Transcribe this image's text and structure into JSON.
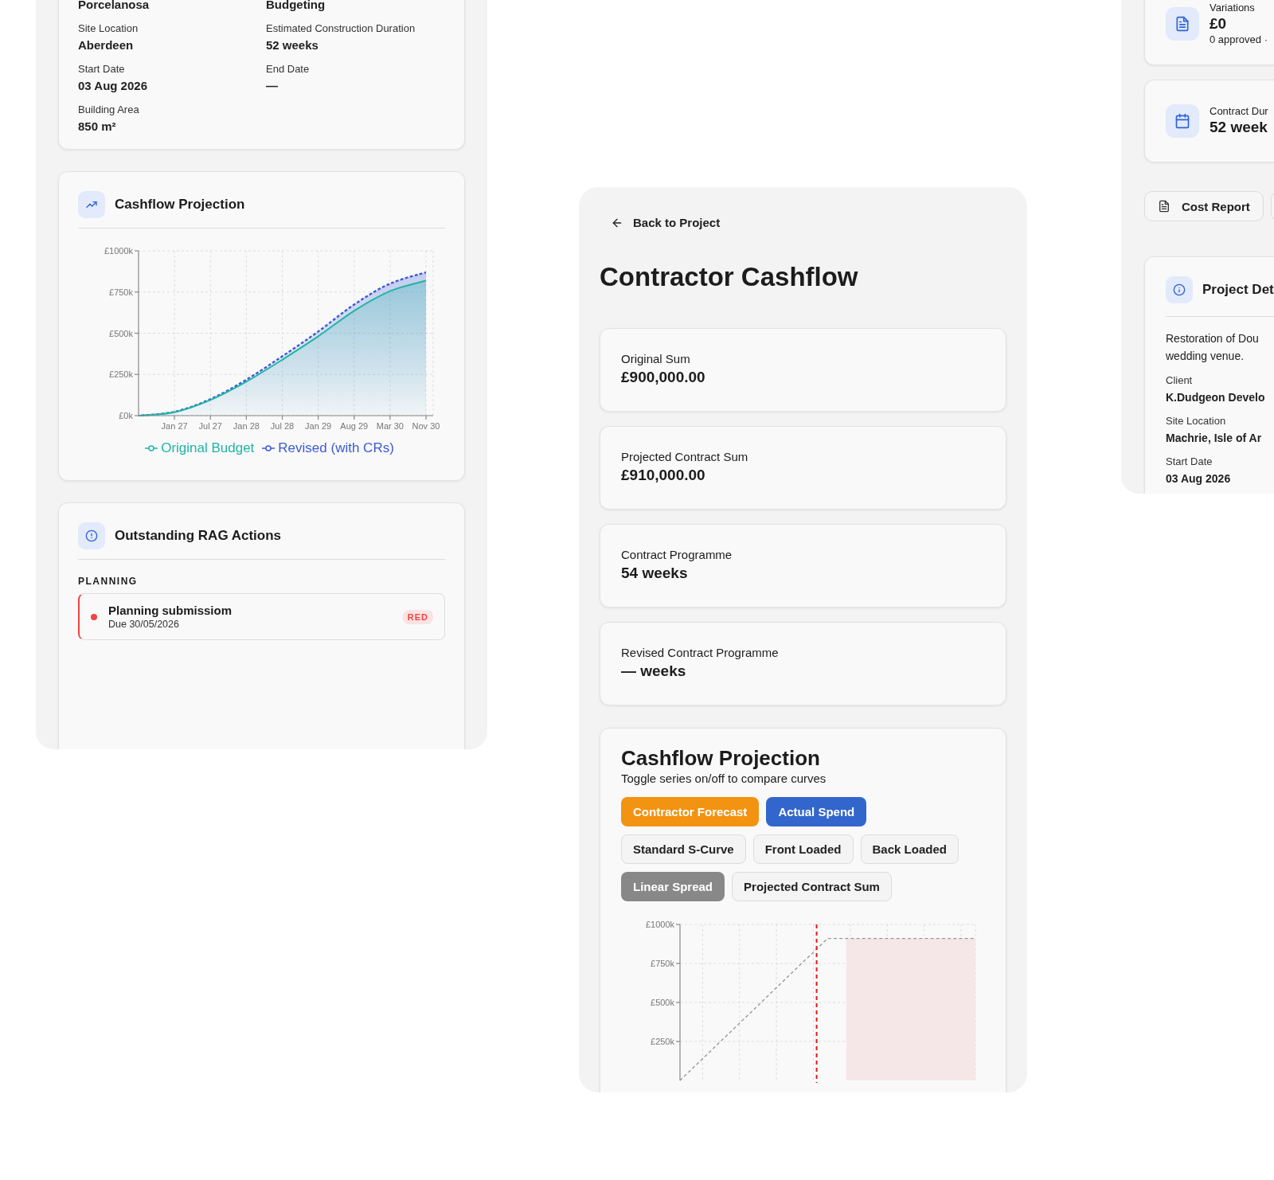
{
  "project_overview_left": {
    "details": [
      {
        "value": "Porcelanosa"
      },
      {
        "value": "Budgeting"
      },
      {
        "label": "Site Location",
        "value": "Aberdeen"
      },
      {
        "label": "Estimated Construction Duration",
        "value": "52 weeks"
      },
      {
        "label": "Start Date",
        "value": "03 Aug 2026"
      },
      {
        "label": "End Date",
        "value": "—"
      },
      {
        "label": "Building Area",
        "value": "850 m²"
      }
    ],
    "cashflow": {
      "title": "Cashflow Projection",
      "chart_data": {
        "type": "area",
        "grid": true,
        "categories": [
          null,
          "Jan 27",
          "Jul 27",
          "Jan 28",
          "Jul 28",
          "Jan 29",
          "Aug 29",
          "Mar 30",
          "Nov 30"
        ],
        "ylim": [
          0,
          1000
        ],
        "yticks": [
          {
            "value": 0,
            "label": "£0k"
          },
          {
            "value": 250,
            "label": "£250k"
          },
          {
            "value": 500,
            "label": "£500k"
          },
          {
            "value": 750,
            "label": "£750k"
          },
          {
            "value": 1000,
            "label": "£1000k"
          }
        ],
        "series": [
          {
            "name": "Original Budget",
            "color": "#1fb5a5",
            "line_style": "solid",
            "values": [
              0,
              21,
              95,
              206,
              339,
              481,
              636,
              755,
              819
            ]
          },
          {
            "name": "Revised (with CRs)",
            "color": "#3b5ad6",
            "line_style": "dashed",
            "values": [
              0,
              23,
              100,
              218,
              360,
              510,
              674,
              801,
              869
            ]
          }
        ]
      }
    },
    "rag": {
      "title": "Outstanding RAG Actions",
      "groups": [
        {
          "name": "PLANNING",
          "items": [
            {
              "title": "Planning submissiom",
              "due": "Due 30/05/2026",
              "status": "RED",
              "color": "#ef4444"
            }
          ]
        }
      ]
    }
  },
  "contractor_cashflow": {
    "back_link": "Back to Project",
    "title": "Contractor Cashflow",
    "stats": [
      {
        "label": "Original Sum",
        "value": "£900,000.00"
      },
      {
        "label": "Projected Contract Sum",
        "value": "£910,000.00"
      },
      {
        "label": "Contract Programme",
        "value": "54 weeks"
      },
      {
        "label": "Revised Contract Programme",
        "value": "— weeks"
      }
    ],
    "projection": {
      "title": "Cashflow Projection",
      "subtitle": "Toggle series on/off to compare curves",
      "toggles": [
        {
          "label": "Contractor Forecast",
          "selected": true,
          "color": "#f39312"
        },
        {
          "label": "Actual Spend",
          "selected": true,
          "color": "#3366cc"
        },
        {
          "label": "Standard S-Curve",
          "selected": false
        },
        {
          "label": "Front Loaded",
          "selected": false
        },
        {
          "label": "Back Loaded",
          "selected": false
        },
        {
          "label": "Linear Spread",
          "selected": true,
          "color": "#888888"
        },
        {
          "label": "Projected Contract Sum",
          "selected": false
        }
      ],
      "chart_data": {
        "type": "line",
        "grid": true,
        "categories": [
          null,
          null,
          null,
          null,
          null,
          null,
          null,
          null,
          null
        ],
        "ylim": [
          0,
          1000
        ],
        "yticks": [
          {
            "value": 250,
            "label": "£250k"
          },
          {
            "value": 500,
            "label": "£500k"
          },
          {
            "value": 750,
            "label": "£750k"
          },
          {
            "value": 1000,
            "label": "£1000k"
          }
        ],
        "series": [
          {
            "color": "#999999",
            "line_style": "dashed",
            "values": [
              0,
              228,
              455,
              683,
              910,
              910,
              910,
              910,
              910
            ]
          }
        ]
      }
    }
  },
  "project_overview_right": {
    "stat_cards": [
      {
        "label": "Variations",
        "value": "£0",
        "note": "0 approved ·"
      },
      {
        "label": "Contract Dur",
        "value": "52 week"
      }
    ],
    "actions": [
      {
        "label": "Cost Report"
      }
    ],
    "project_details": {
      "title": "Project Det",
      "description_lines": [
        "Restoration of Dou",
        "wedding venue."
      ],
      "fields": [
        {
          "label": "Client",
          "value": "K.Dudgeon Develo"
        },
        {
          "label": "Site Location",
          "value": "Machrie, Isle of Ar"
        },
        {
          "label": "Start Date",
          "value": "03 Aug 2026"
        }
      ]
    }
  }
}
